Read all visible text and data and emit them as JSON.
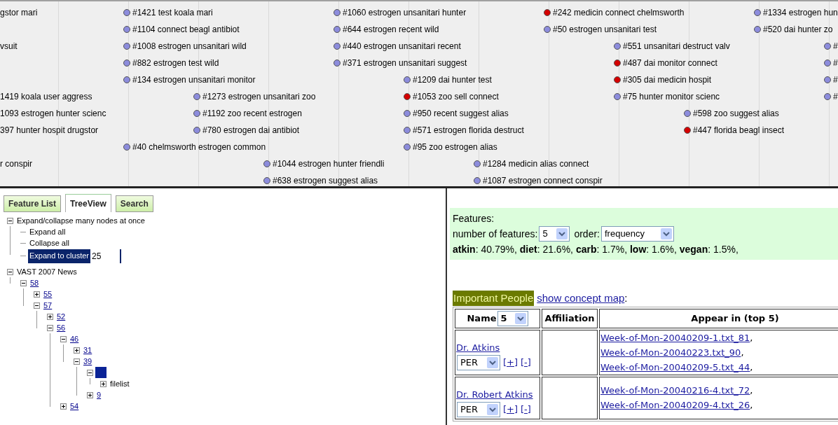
{
  "timeline": {
    "rows": [
      {
        "items": [
          {
            "label": "gstor mari"
          },
          {
            "label": "#1421 test koala mari",
            "color": "#8c8cdc"
          },
          {
            "label": "#1060 estrogen unsanitari hunter",
            "color": "#8c8cdc"
          },
          {
            "label": "#242 medicin connect chelmsworth",
            "color": "#d40000"
          },
          {
            "label": "#1334 estrogen hun",
            "color": "#8c8cdc"
          }
        ]
      },
      {
        "items": [
          {
            "label": "#1104 connect beagl antibiot",
            "color": "#8c8cdc"
          },
          {
            "label": "#644 estrogen recent wild",
            "color": "#8c8cdc"
          },
          {
            "label": "#50 estrogen unsanitari test",
            "color": "#8c8cdc"
          },
          {
            "label": "#520 dai hunter zo",
            "color": "#8c8cdc"
          }
        ]
      },
      {
        "items": [
          {
            "label": "vsuit"
          },
          {
            "label": "#1008 estrogen unsanitari wild",
            "color": "#8c8cdc"
          },
          {
            "label": "#440 estrogen unsanitari recent",
            "color": "#8c8cdc"
          },
          {
            "label": "#551 unsanitari destruct valv",
            "color": "#8c8cdc"
          },
          {
            "label": "#",
            "color": "#8c8cdc"
          }
        ]
      },
      {
        "items": [
          {
            "label": "#882 estrogen test wild",
            "color": "#8c8cdc"
          },
          {
            "label": "#371 estrogen unsanitari suggest",
            "color": "#8c8cdc"
          },
          {
            "label": "#487 dai monitor connect",
            "color": "#d40000"
          },
          {
            "label": "#",
            "color": "#8c8cdc"
          }
        ]
      },
      {
        "items": [
          {
            "label": "#134 estrogen unsanitari monitor",
            "color": "#8c8cdc"
          },
          {
            "label": "#1209 dai hunter test",
            "color": "#8c8cdc"
          },
          {
            "label": "#305 dai medicin hospit",
            "color": "#d40000"
          },
          {
            "label": "#",
            "color": "#8c8cdc"
          }
        ]
      },
      {
        "items": [
          {
            "label": "1419 koala user aggress"
          },
          {
            "label": "#1273 estrogen unsanitari zoo",
            "color": "#8c8cdc"
          },
          {
            "label": "#1053 zoo sell connect",
            "color": "#d40000"
          },
          {
            "label": "#75 hunter monitor scienc",
            "color": "#8c8cdc"
          },
          {
            "label": "#",
            "color": "#8c8cdc"
          }
        ]
      },
      {
        "items": [
          {
            "label": "1093 estrogen hunter scienc"
          },
          {
            "label": "#1192 zoo recent estrogen",
            "color": "#8c8cdc"
          },
          {
            "label": "#950 recent suggest alias",
            "color": "#8c8cdc"
          },
          {
            "label": "#598 zoo suggest alias",
            "color": "#8c8cdc"
          }
        ]
      },
      {
        "items": [
          {
            "label": "397 hunter hospit drugstor"
          },
          {
            "label": "#780 estrogen dai antibiot",
            "color": "#8c8cdc"
          },
          {
            "label": "#571 estrogen florida destruct",
            "color": "#8c8cdc"
          },
          {
            "label": "#447 florida beagl insect",
            "color": "#d40000"
          }
        ]
      },
      {
        "items": [
          {
            "label": "#40 chelmsworth estrogen common",
            "color": "#8c8cdc"
          },
          {
            "label": "#95 zoo estrogen alias",
            "color": "#8c8cdc"
          }
        ]
      },
      {
        "items": [
          {
            "label": "r conspir"
          },
          {
            "label": "#1044 estrogen hunter friendli",
            "color": "#8c8cdc"
          },
          {
            "label": "#1284 medicin alias connect",
            "color": "#8c8cdc"
          }
        ]
      },
      {
        "items": [
          {
            "label": "#638 estrogen suggest alias",
            "color": "#8c8cdc"
          },
          {
            "label": "#1087 estrogen connect conspir",
            "color": "#8c8cdc"
          }
        ]
      }
    ]
  },
  "tabs": [
    {
      "label": "Feature List",
      "selected": false
    },
    {
      "label": "TreeView",
      "selected": true
    },
    {
      "label": "Search",
      "selected": false
    }
  ],
  "tree": [
    {
      "kind": "text",
      "label": "Expand/collapse many nodes at once",
      "expanded": true,
      "selected": false,
      "children": [
        {
          "kind": "text",
          "label": "Expand all",
          "selected": false
        },
        {
          "kind": "text",
          "label": "Collapse all",
          "selected": false
        },
        {
          "kind": "field",
          "label": "Expand to cluster",
          "value": "25",
          "selected": true
        }
      ]
    },
    {
      "kind": "text",
      "label": "VAST 2007 News",
      "expanded": true,
      "selected": false,
      "children": [
        {
          "kind": "link",
          "label": "58",
          "expanded": true,
          "selected": false,
          "children": [
            {
              "kind": "link",
              "label": "55",
              "expanded": false,
              "selected": false
            },
            {
              "kind": "link",
              "label": "57",
              "expanded": true,
              "selected": false,
              "children": [
                {
                  "kind": "link",
                  "label": "52",
                  "expanded": false,
                  "selected": false
                },
                {
                  "kind": "link",
                  "label": "56",
                  "expanded": true,
                  "selected": false,
                  "children": [
                    {
                      "kind": "link",
                      "label": "46",
                      "expanded": true,
                      "selected": false,
                      "children": [
                        {
                          "kind": "link",
                          "label": "31",
                          "expanded": false,
                          "selected": false
                        },
                        {
                          "kind": "link",
                          "label": "39",
                          "expanded": true,
                          "selected": false,
                          "children": [
                            {
                              "kind": "marker",
                              "expanded": true,
                              "selected": true,
                              "children": [
                                {
                                  "kind": "text",
                                  "label": "filelist",
                                  "expanded": false,
                                  "selected": false
                                }
                              ]
                            },
                            {
                              "kind": "link",
                              "label": "9",
                              "expanded": false,
                              "selected": false
                            }
                          ]
                        }
                      ]
                    },
                    {
                      "kind": "link",
                      "label": "54",
                      "expanded": false,
                      "selected": false
                    }
                  ]
                }
              ]
            }
          ]
        }
      ]
    }
  ],
  "features": {
    "title": "Features:",
    "count_label": "number of features:",
    "count_value": "5",
    "order_label": "order:",
    "order_value": "frequency",
    "summary": "**atkin**: 40.79%, **diet**: 21.6%, **carb**: 1.7%, **low**: 1.6%, **vegan**: 1.5%,"
  },
  "people": {
    "heading": "Important People",
    "link": "show concept map",
    "suffix": ":",
    "columns": [
      {
        "label": "Name",
        "select": "5"
      },
      {
        "label": "Affiliation"
      },
      {
        "label": "Appear in (top 5)"
      }
    ],
    "rows": [
      {
        "name": "Dr. Atkins",
        "type": "PER",
        "actions": [
          "[+]",
          "[-]"
        ],
        "appearances": [
          "Week-of-Mon-20040209-1.txt_81",
          "Week-of-Mon-20040223.txt_90",
          "Week-of-Mon-20040209-5.txt_44"
        ],
        "separator": ","
      },
      {
        "name": "Dr. Robert Atkins",
        "type": "PER",
        "actions": [
          "[+]",
          "[-]"
        ],
        "appearances": [
          "Week-of-Mon-20040216-4.txt_72",
          "Week-of-Mon-20040209-4.txt_26"
        ],
        "separator": ","
      }
    ]
  }
}
